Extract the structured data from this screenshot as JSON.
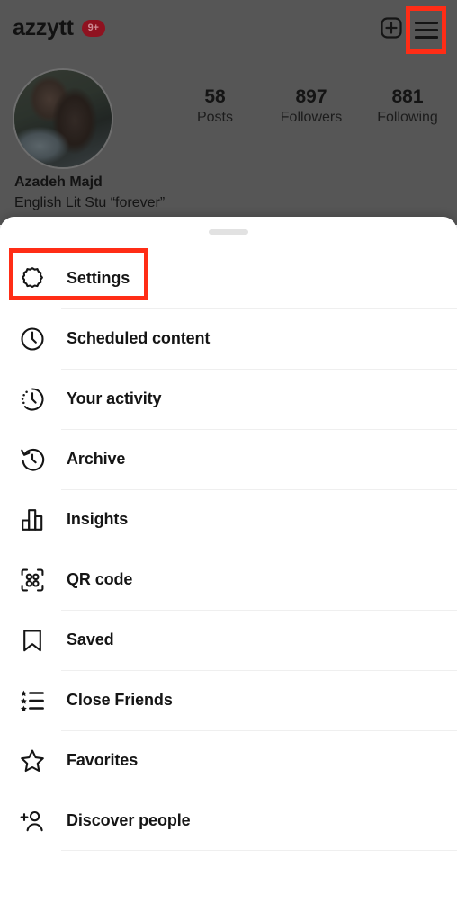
{
  "profile": {
    "username": "azzytt",
    "notification_badge": "9+",
    "full_name": "Azadeh Majd",
    "bio": "English Lit Stu “forever”",
    "avatar_alt": "profile-photo",
    "stats": [
      {
        "value": "58",
        "label": "Posts"
      },
      {
        "value": "897",
        "label": "Followers"
      },
      {
        "value": "881",
        "label": "Following"
      }
    ],
    "actions": {
      "create_label": "create-post",
      "menu_label": "open-menu"
    }
  },
  "sheet": {
    "grabber_label": "drag-handle",
    "items": [
      {
        "label": "Settings",
        "icon": "gear-icon"
      },
      {
        "label": "Scheduled content",
        "icon": "clock-icon"
      },
      {
        "label": "Your activity",
        "icon": "activity-clock-icon"
      },
      {
        "label": "Archive",
        "icon": "archive-clock-icon"
      },
      {
        "label": "Insights",
        "icon": "bar-chart-icon"
      },
      {
        "label": "QR code",
        "icon": "qr-code-icon"
      },
      {
        "label": "Saved",
        "icon": "bookmark-icon"
      },
      {
        "label": "Close Friends",
        "icon": "star-list-icon"
      },
      {
        "label": "Favorites",
        "icon": "star-icon"
      },
      {
        "label": "Discover people",
        "icon": "person-plus-icon"
      }
    ]
  },
  "highlights": {
    "color": "#ff2d16",
    "targets": [
      "menu-button",
      "settings-row"
    ]
  },
  "colors": {
    "dim_background": "#565656",
    "sheet_background": "#ffffff",
    "badge_background": "#8f1220",
    "text_primary": "#151515",
    "divider": "#efefef"
  }
}
